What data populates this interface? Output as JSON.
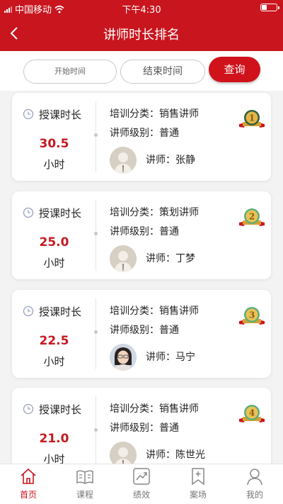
{
  "status_bar": {
    "carrier": "中国移动",
    "time": "下午4:30"
  },
  "nav": {
    "title": "讲师时长排名"
  },
  "filter": {
    "start_placeholder": "开始时间",
    "end_placeholder": "结束时间",
    "query_label": "查询"
  },
  "cards": [
    {
      "hours_label": "授课时长",
      "hours": "30.5",
      "unit": "小时",
      "category": "培训分类：销售讲师",
      "level": "讲师级别：普通",
      "teacher": "讲师：张静",
      "rank": "1"
    },
    {
      "hours_label": "授课时长",
      "hours": "25.0",
      "unit": "小时",
      "category": "培训分类：策划讲师",
      "level": "讲师级别：普通",
      "teacher": "讲师：丁梦",
      "rank": "2"
    },
    {
      "hours_label": "授课时长",
      "hours": "22.5",
      "unit": "小时",
      "category": "培训分类：销售讲师",
      "level": "讲师级别：普通",
      "teacher": "讲师：马宁",
      "rank": "3"
    },
    {
      "hours_label": "授课时长",
      "hours": "21.0",
      "unit": "小时",
      "category": "培训分类：销售讲师",
      "level": "讲师级别：普通",
      "teacher": "讲师：陈世光",
      "rank": "4"
    }
  ],
  "tabs": [
    {
      "label": "首页",
      "icon": "home-icon"
    },
    {
      "label": "课程",
      "icon": "book-icon"
    },
    {
      "label": "绩效",
      "icon": "chart-icon"
    },
    {
      "label": "案场",
      "icon": "bookmark-icon"
    },
    {
      "label": "我的",
      "icon": "user-icon"
    }
  ],
  "colors": {
    "brand": "#c9151e",
    "value": "#c41a22"
  }
}
